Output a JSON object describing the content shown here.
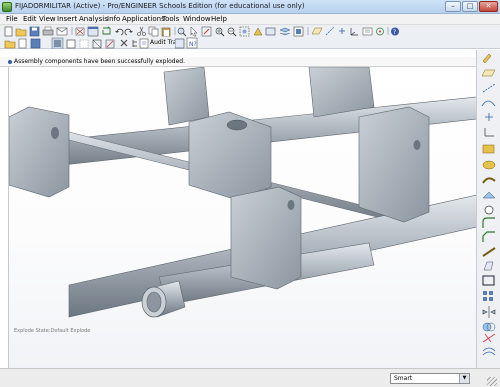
{
  "window": {
    "title": "FIJADORMILITAR (Active) - Pro/ENGINEER Schools Edition (for educational use only)",
    "minimize_glyph": "–",
    "maximize_glyph": "□",
    "close_glyph": "✕"
  },
  "menu": [
    "File",
    "Edit",
    "View",
    "Insert",
    "Analysis",
    "Info",
    "Applications",
    "Tools",
    "Window",
    "Help"
  ],
  "toolbar": {
    "audit_trail_label": "Audit Trail"
  },
  "message": {
    "text": "Assembly components have been successfully exploded."
  },
  "viewport": {
    "state_label": "Explode State:Default Explode",
    "model_color": "#a9b3bc",
    "model_shadow": "#6f7a84"
  },
  "statusbar": {
    "filter_value": "Smart",
    "filter_arrow": "▼"
  },
  "colors": {
    "accent": "#3d5aa8",
    "titlebar": "#c4dbf3"
  },
  "icons": {
    "toolbar1": [
      "new-icon",
      "open-icon",
      "save-icon",
      "print-icon",
      "email-icon",
      "erase-icon",
      "window-icon",
      "regenerate-icon",
      "undo-icon",
      "redo-icon",
      "cut-icon",
      "copy-icon",
      "paste-icon",
      "find-icon",
      "select-icon",
      "repaint-icon",
      "zoom-in-icon",
      "zoom-out-icon",
      "refit-icon",
      "orient-icon",
      "saved-views-icon",
      "layers-icon",
      "view-manager-icon",
      "datum-plane-icon",
      "datum-axis-icon",
      "datum-point-icon",
      "csys-icon",
      "annotation-icon",
      "spin-center-icon",
      "help-icon"
    ],
    "toolbar2": [
      "folder-icon",
      "new-file-icon",
      "save-copy-icon",
      "shading-icon",
      "no-hidden-icon",
      "hidden-line-icon",
      "wireframe-icon",
      "graphics-icon",
      "close-window-icon",
      "model-tree-icon",
      "audit-icon",
      "explode-icon",
      "whats-this-icon"
    ],
    "right": [
      "sketch-icon",
      "datum-plane-icon",
      "axis-icon",
      "curve-icon",
      "point-icon",
      "csys-icon",
      "extrude-icon",
      "revolve-icon",
      "sweep-icon",
      "blend-icon",
      "hole-icon",
      "round-icon",
      "chamfer-icon",
      "rib-icon",
      "draft-icon",
      "shell-icon",
      "pattern-icon",
      "mirror-icon",
      "merge-icon",
      "trim-icon",
      "offset-icon",
      "thicken-icon",
      "solidify-icon",
      "style-icon",
      "warp-icon"
    ]
  }
}
